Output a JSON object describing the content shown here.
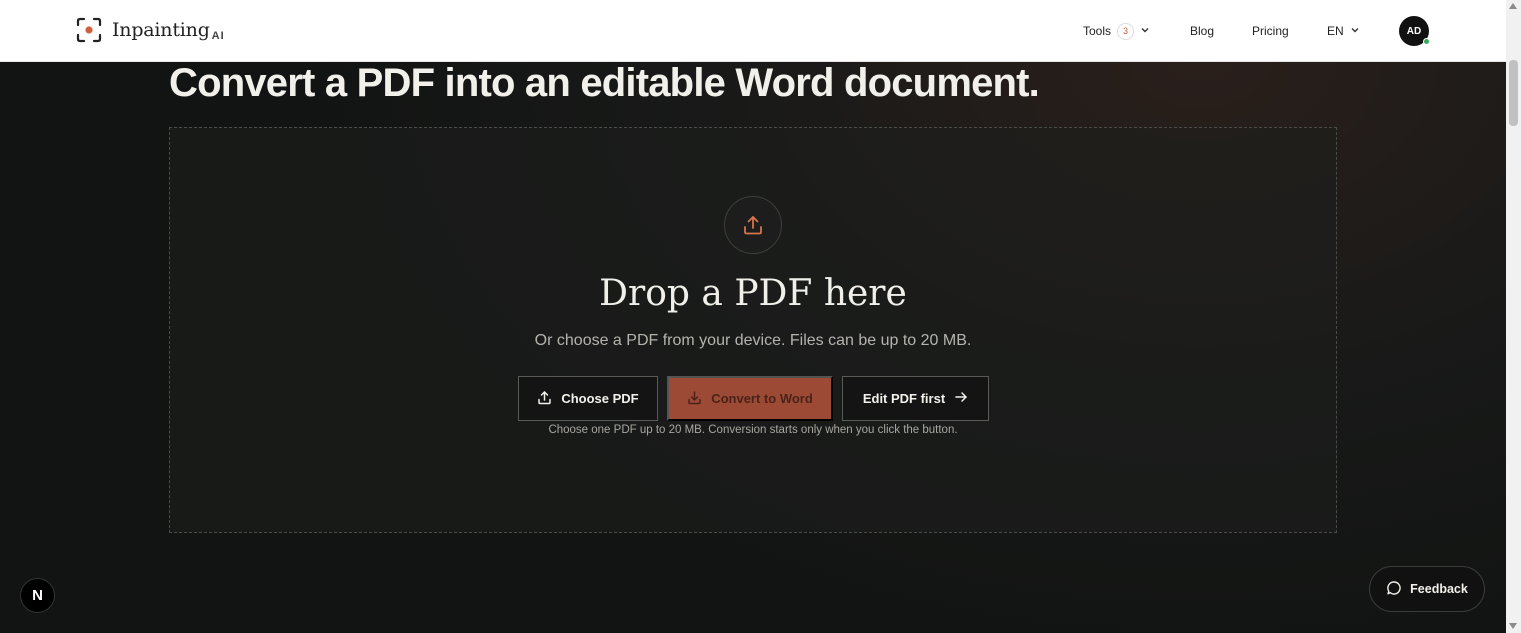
{
  "header": {
    "logo_text": "Inpainting",
    "logo_sub": "AI",
    "nav": {
      "tools_label": "Tools",
      "tools_badge": "3",
      "blog_label": "Blog",
      "pricing_label": "Pricing",
      "lang_label": "EN"
    },
    "avatar_initials": "AD"
  },
  "main": {
    "headline": "Convert a PDF into an editable Word document.",
    "dropzone": {
      "icon": "upload-icon",
      "title": "Drop a PDF here",
      "subtitle": "Or choose a PDF from your device. Files can be up to 20 MB.",
      "buttons": {
        "choose_label": "Choose PDF",
        "convert_label": "Convert to Word",
        "edit_label": "Edit PDF first"
      },
      "hint": "Choose one PDF up to 20 MB. Conversion starts only when you click the button."
    }
  },
  "floating": {
    "next_badge": "N",
    "feedback_label": "Feedback"
  },
  "colors": {
    "accent": "#c0623e",
    "convert_button_bg": "#9c4a35",
    "page_bg": "#141615"
  }
}
